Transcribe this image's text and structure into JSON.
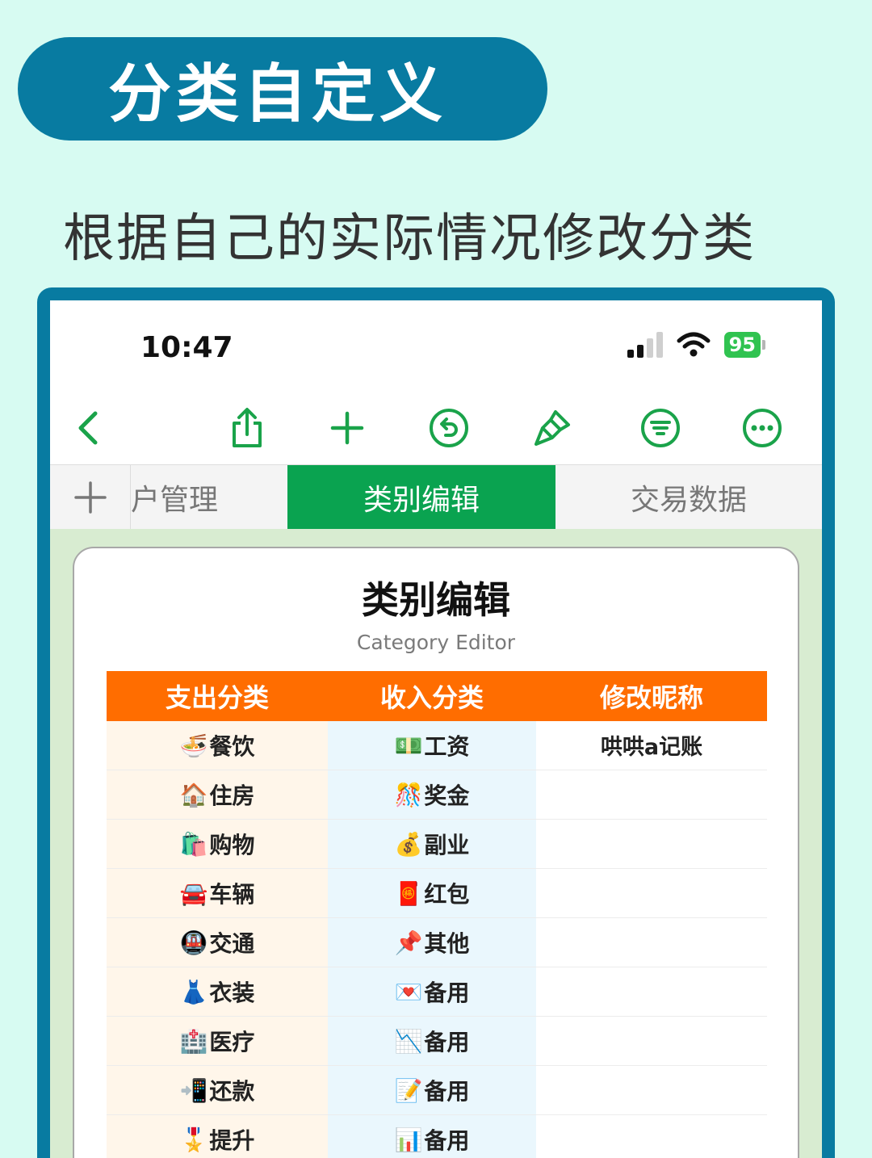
{
  "header": {
    "title": "分类自定义",
    "subtitle": "根据自己的实际情况修改分类"
  },
  "status_bar": {
    "time": "10:47",
    "battery": "95"
  },
  "toolbar": {
    "icons": [
      "back-icon",
      "share-icon",
      "add-icon",
      "undo-icon",
      "brush-icon",
      "filter-icon",
      "more-icon"
    ],
    "accent": "#1aa34a"
  },
  "tabs": {
    "add_label": "+",
    "items": [
      {
        "label": "户管理"
      },
      {
        "label": "类别编辑"
      },
      {
        "label": "交易数据"
      }
    ],
    "active_color": "#0aa350"
  },
  "sheet": {
    "title": "类别编辑",
    "subtitle": "Category Editor",
    "columns": [
      "支出分类",
      "收入分类",
      "修改昵称"
    ],
    "nickname": "哄哄a记账",
    "header_color": "#ff6d00",
    "expense": [
      {
        "emoji": "🍜",
        "label": "餐饮"
      },
      {
        "emoji": "🏠",
        "label": "住房"
      },
      {
        "emoji": "🛍️",
        "label": "购物"
      },
      {
        "emoji": "🚘",
        "label": "车辆"
      },
      {
        "emoji": "🚇",
        "label": "交通"
      },
      {
        "emoji": "👗",
        "label": "衣装"
      },
      {
        "emoji": "🏥",
        "label": "医疗"
      },
      {
        "emoji": "📲",
        "label": "还款"
      },
      {
        "emoji": "🎖️",
        "label": "提升"
      }
    ],
    "income": [
      {
        "emoji": "💵",
        "label": "工资"
      },
      {
        "emoji": "🎊",
        "label": "奖金"
      },
      {
        "emoji": "💰",
        "label": "副业"
      },
      {
        "emoji": "🧧",
        "label": "红包"
      },
      {
        "emoji": "📌",
        "label": "其他"
      },
      {
        "emoji": "💌",
        "label": "备用"
      },
      {
        "emoji": "📉",
        "label": "备用"
      },
      {
        "emoji": "📝",
        "label": "备用"
      },
      {
        "emoji": "📊",
        "label": "备用"
      }
    ]
  }
}
